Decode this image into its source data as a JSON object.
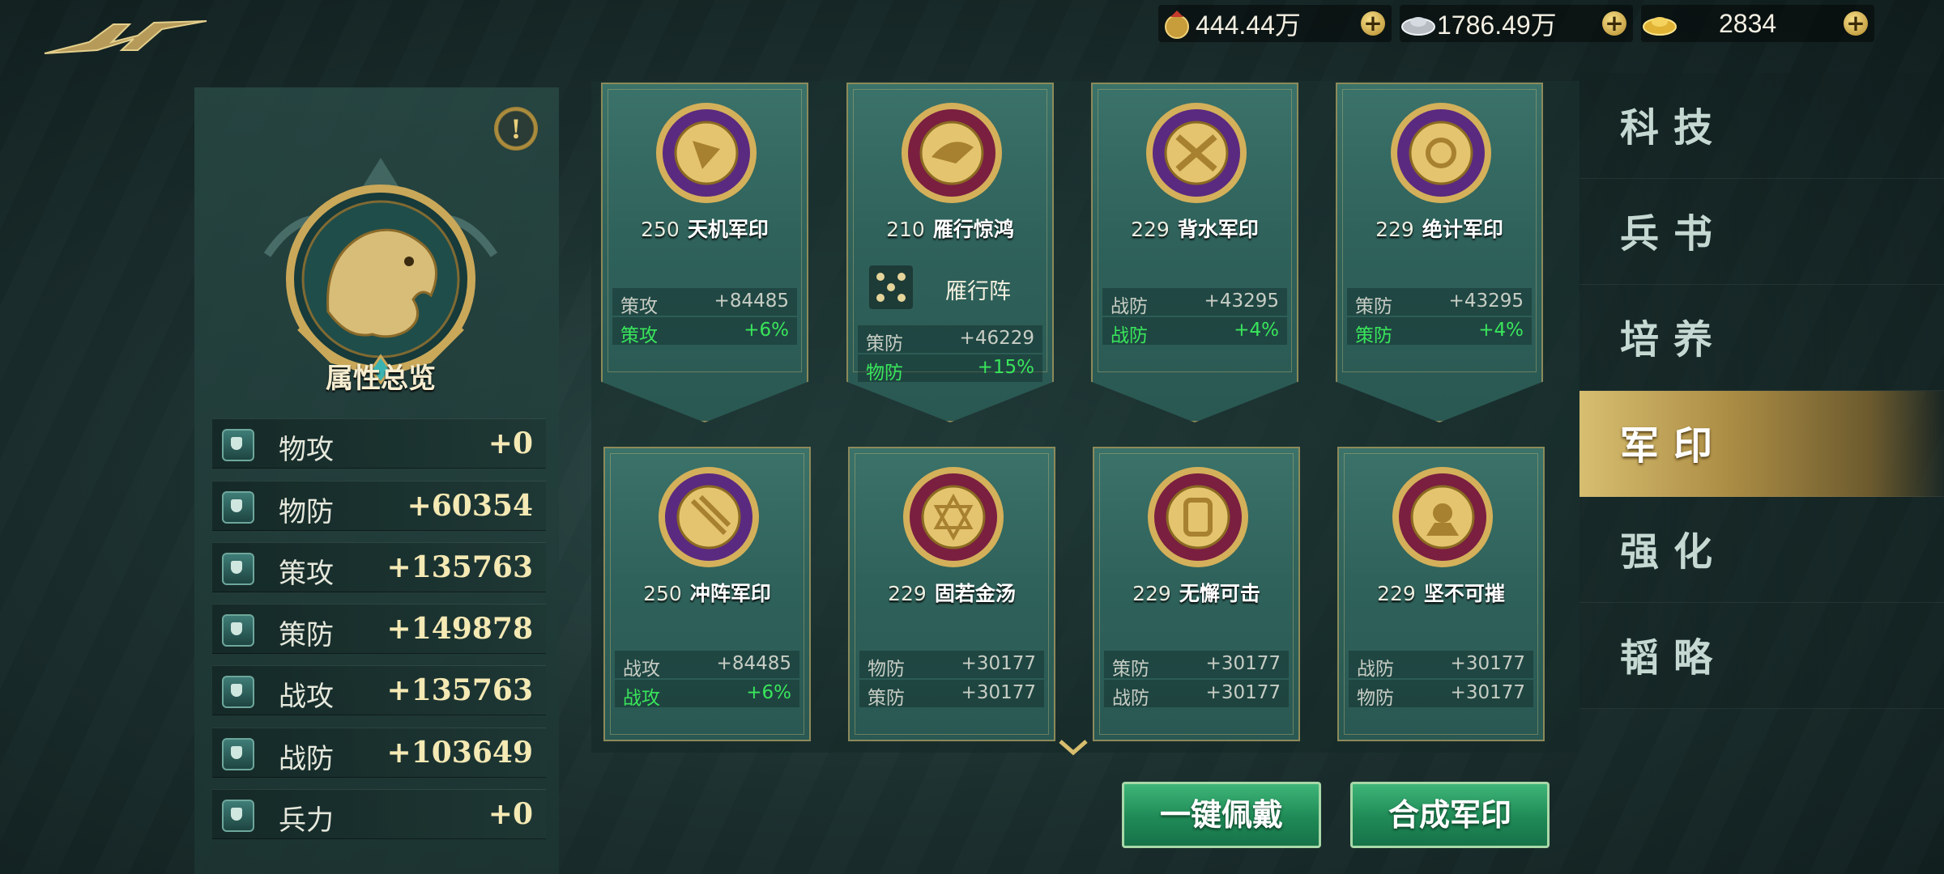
{
  "currency": [
    {
      "icon": "coin-pouch-icon",
      "value": "444.44万"
    },
    {
      "icon": "silver-ingot-icon",
      "value": "1786.49万"
    },
    {
      "icon": "gold-ingot-icon",
      "value": "2834"
    }
  ],
  "overview": {
    "title": "属性总览",
    "stats": [
      {
        "name": "物攻",
        "value": "+0",
        "icon": "sword-icon"
      },
      {
        "name": "物防",
        "value": "+60354",
        "icon": "armor-icon"
      },
      {
        "name": "策攻",
        "value": "+135763",
        "icon": "book-icon"
      },
      {
        "name": "策防",
        "value": "+149878",
        "icon": "shield-icon"
      },
      {
        "name": "战攻",
        "value": "+135763",
        "icon": "horse-icon"
      },
      {
        "name": "战防",
        "value": "+103649",
        "icon": "armor-icon"
      },
      {
        "name": "兵力",
        "value": "+0",
        "icon": "troops-icon"
      }
    ]
  },
  "seals": [
    {
      "level": "250",
      "name": "天机军印",
      "medal_color": "#5a2a80",
      "rows": [
        {
          "k": "策攻",
          "v": "+84485",
          "green": false
        },
        {
          "k": "策攻",
          "v": "+6%",
          "green": true
        }
      ]
    },
    {
      "level": "210",
      "name": "雁行惊鸿",
      "medal_color": "#7a1f40",
      "formation": "雁行阵",
      "rows": [
        {
          "k": "策防",
          "v": "+46229",
          "green": false
        },
        {
          "k": "物防",
          "v": "+15%",
          "green": true
        }
      ]
    },
    {
      "level": "229",
      "name": "背水军印",
      "medal_color": "#5a2a80",
      "rows": [
        {
          "k": "战防",
          "v": "+43295",
          "green": false
        },
        {
          "k": "战防",
          "v": "+4%",
          "green": true
        }
      ]
    },
    {
      "level": "229",
      "name": "绝计军印",
      "medal_color": "#5a2a80",
      "rows": [
        {
          "k": "策防",
          "v": "+43295",
          "green": false
        },
        {
          "k": "策防",
          "v": "+4%",
          "green": true
        }
      ]
    },
    {
      "level": "250",
      "name": "冲阵军印",
      "medal_color": "#5a2a80",
      "rows": [
        {
          "k": "战攻",
          "v": "+84485",
          "green": false
        },
        {
          "k": "战攻",
          "v": "+6%",
          "green": true
        }
      ]
    },
    {
      "level": "229",
      "name": "固若金汤",
      "medal_color": "#7a1f40",
      "rows": [
        {
          "k": "物防",
          "v": "+30177",
          "green": false
        },
        {
          "k": "策防",
          "v": "+30177",
          "green": false
        }
      ]
    },
    {
      "level": "229",
      "name": "无懈可击",
      "medal_color": "#7a1f40",
      "rows": [
        {
          "k": "策防",
          "v": "+30177",
          "green": false
        },
        {
          "k": "战防",
          "v": "+30177",
          "green": false
        }
      ]
    },
    {
      "level": "229",
      "name": "坚不可摧",
      "medal_color": "#7a1f40",
      "rows": [
        {
          "k": "战防",
          "v": "+30177",
          "green": false
        },
        {
          "k": "物防",
          "v": "+30177",
          "green": false
        }
      ]
    }
  ],
  "buttons": {
    "equip_all": "一键佩戴",
    "synthesize": "合成军印"
  },
  "tabs": [
    {
      "label": "科技",
      "active": false
    },
    {
      "label": "兵书",
      "active": false
    },
    {
      "label": "培养",
      "active": false
    },
    {
      "label": "军印",
      "active": true
    },
    {
      "label": "强化",
      "active": false
    },
    {
      "label": "韬略",
      "active": false
    }
  ]
}
